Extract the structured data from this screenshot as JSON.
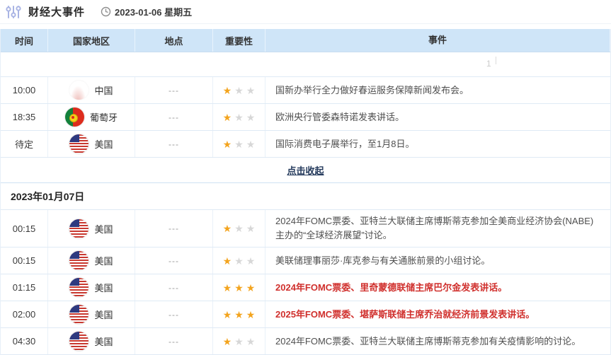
{
  "header": {
    "title": "财经大事件",
    "date": "2023-01-06 星期五"
  },
  "table": {
    "columns": [
      "时间",
      "国家地区",
      "地点",
      "重要性",
      "事件"
    ],
    "stray_text": "1",
    "collapse_label": "点击收起",
    "date_separator": "2023年01月07日",
    "rows_day1": [
      {
        "time": "10:00",
        "country": "中国",
        "flag": "cn",
        "location": "---",
        "importance": 1,
        "event": "国新办举行全力做好春运服务保障新闻发布会。",
        "highlight": false
      },
      {
        "time": "18:35",
        "country": "葡萄牙",
        "flag": "pt",
        "location": "---",
        "importance": 1,
        "event": "欧洲央行管委森特诺发表讲话。",
        "highlight": false
      },
      {
        "time": "待定",
        "country": "美国",
        "flag": "us",
        "location": "---",
        "importance": 1,
        "event": "国际消费电子展举行，至1月8日。",
        "highlight": false
      }
    ],
    "rows_day2": [
      {
        "time": "00:15",
        "country": "美国",
        "flag": "us",
        "location": "---",
        "importance": 1,
        "event": "2024年FOMC票委、亚特兰大联储主席博斯蒂克参加全美商业经济协会(NABE)主办的“全球经济展望”讨论。",
        "highlight": false
      },
      {
        "time": "00:15",
        "country": "美国",
        "flag": "us",
        "location": "---",
        "importance": 1,
        "event": "美联储理事丽莎·库克参与有关通胀前景的小组讨论。",
        "highlight": false
      },
      {
        "time": "01:15",
        "country": "美国",
        "flag": "us",
        "location": "---",
        "importance": 3,
        "event": "2024年FOMC票委、里奇蒙德联储主席巴尔金发表讲话。",
        "highlight": true
      },
      {
        "time": "02:00",
        "country": "美国",
        "flag": "us",
        "location": "---",
        "importance": 3,
        "event": "2025年FOMC票委、堪萨斯联储主席乔治就经济前景发表讲话。",
        "highlight": true
      },
      {
        "time": "04:30",
        "country": "美国",
        "flag": "us",
        "location": "---",
        "importance": 1,
        "event": "2024年FOMC票委、亚特兰大联储主席博斯蒂克参加有关疫情影响的讨论。",
        "highlight": false
      }
    ]
  },
  "colors": {
    "header_bg": "#cfe5f8",
    "star_filled": "#f3a41e",
    "star_empty": "#d7d7d7",
    "highlight_red": "#d0302d",
    "icon_periwinkle": "#a9b4e4"
  }
}
